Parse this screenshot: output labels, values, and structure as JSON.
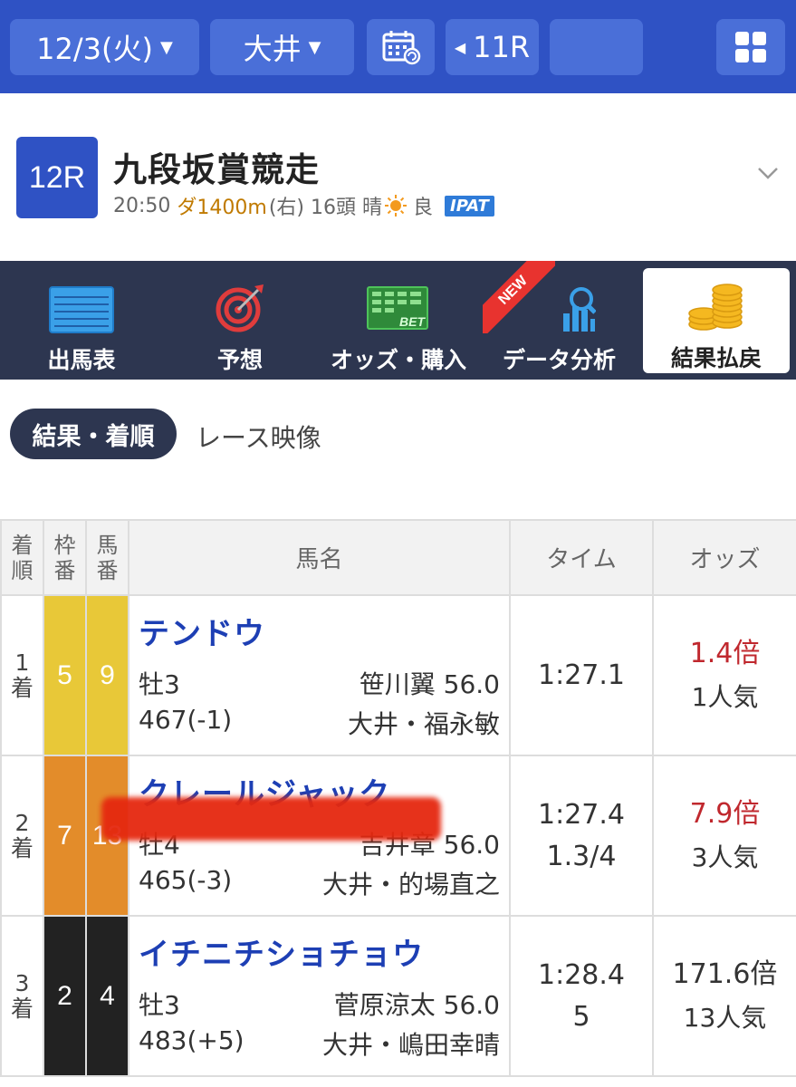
{
  "topbar": {
    "date": "12/3(火)",
    "venue": "大井",
    "prev_race": "11R",
    "next_race": ""
  },
  "race": {
    "number": "12R",
    "title": "九段坂賞競走",
    "time": "20:50",
    "course": "ダ1400m",
    "direction": "(右)",
    "runners": "16頭",
    "weather": "晴",
    "going": "良",
    "ipat": "IPAT"
  },
  "tabs": [
    {
      "label": "出馬表",
      "icon": "race-card-icon"
    },
    {
      "label": "予想",
      "icon": "target-icon"
    },
    {
      "label": "オッズ・購入",
      "icon": "bet-board-icon"
    },
    {
      "label": "データ分析",
      "icon": "chart-search-icon",
      "badge": "NEW"
    },
    {
      "label": "結果払戻",
      "icon": "coins-icon",
      "active": true
    }
  ],
  "subtabs": {
    "active": "結果・着順",
    "other": "レース映像"
  },
  "table": {
    "headers": {
      "rank": [
        "着",
        "順"
      ],
      "waku": [
        "枠",
        "番"
      ],
      "umaban": [
        "馬",
        "番"
      ],
      "name": "馬名",
      "time": "タイム",
      "odds": "オッズ"
    },
    "rows": [
      {
        "rank": [
          "1",
          "着"
        ],
        "waku": "5",
        "umaban": "9",
        "waku_color": "#e8c838",
        "name": "テンドウ",
        "sex_age": "牡3",
        "jockey": "笹川翼 56.0",
        "weight": "467(-1)",
        "trainer": "大井・福永敏",
        "time": "1:27.1",
        "margin": "",
        "odds": "1.4倍",
        "popularity": "1人気",
        "odds_red": true
      },
      {
        "rank": [
          "2",
          "着"
        ],
        "waku": "7",
        "umaban": "13",
        "waku_color": "#e38c2a",
        "name": "クレールジャック",
        "sex_age": "牡4",
        "jockey": "吉井章 56.0",
        "weight": "465(-3)",
        "trainer": "大井・的場直之",
        "time": "1:27.4",
        "margin": "1.3/4",
        "odds": "7.9倍",
        "popularity": "3人気",
        "odds_red": true
      },
      {
        "rank": [
          "3",
          "着"
        ],
        "waku": "2",
        "umaban": "4",
        "waku_color": "#222222",
        "name": "イチニチショチョウ",
        "sex_age": "牡3",
        "jockey": "菅原涼太 56.0",
        "weight": "483(+5)",
        "trainer": "大井・嶋田幸晴",
        "time": "1:28.4",
        "margin": "5",
        "odds": "171.6倍",
        "popularity": "13人気",
        "odds_red": false
      }
    ]
  }
}
